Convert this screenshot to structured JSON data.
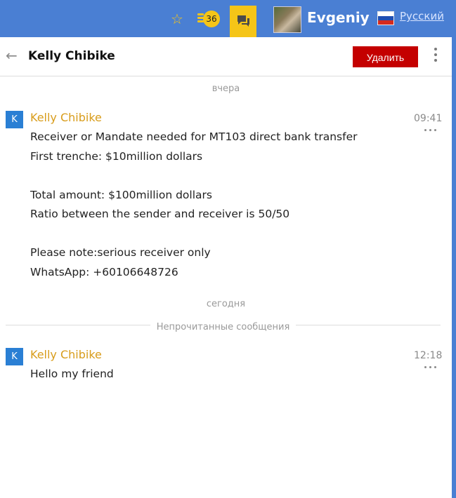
{
  "topbar": {
    "notification_count": "36",
    "username": "Evgeniy",
    "language": "Русский"
  },
  "header": {
    "title": "Kelly Chibike",
    "delete_label": "Удалить"
  },
  "separators": {
    "yesterday": "вчера",
    "today": "сегодня",
    "unread": "Непрочитанные сообщения"
  },
  "messages": [
    {
      "avatar_letter": "K",
      "sender": "Kelly Chibike",
      "time": "09:41",
      "text": "Receiver or Mandate needed for MT103 direct bank transfer\nFirst trenche: $10million dollars\n\nTotal amount: $100million dollars\nRatio between the sender and receiver is 50/50\n\nPlease note:serious receiver only\nWhatsApp: +60106648726"
    },
    {
      "avatar_letter": "K",
      "sender": "Kelly Chibike",
      "time": "12:18",
      "text": "Hello my friend"
    }
  ],
  "colors": {
    "topbar_bg": "#4a7fd3",
    "accent_yellow": "#f5c518",
    "sender_color": "#d89c1a",
    "delete_bg": "#c40000",
    "badge_blue": "#2a7fd4"
  }
}
